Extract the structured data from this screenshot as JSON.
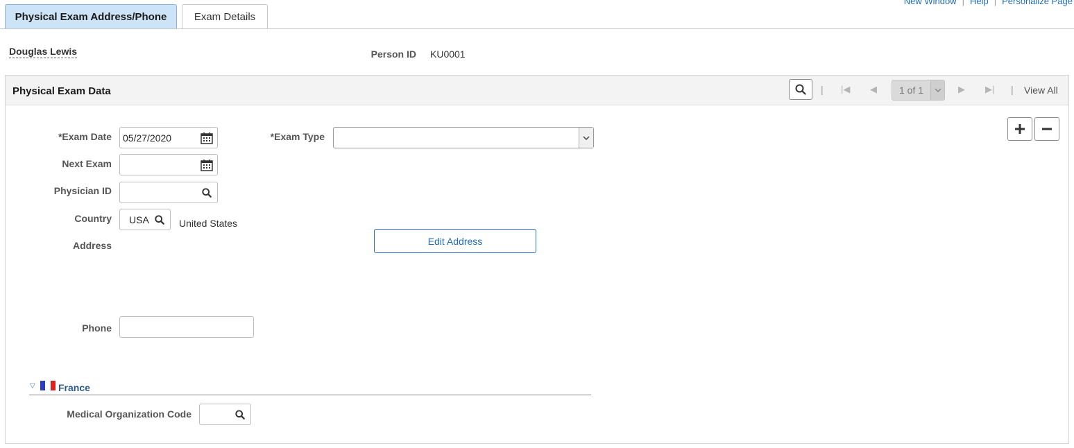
{
  "top_links": {
    "new_window": "New Window",
    "help": "Help",
    "personalize": "Personalize Page"
  },
  "tabs": [
    {
      "label": "Physical Exam Address/Phone",
      "active": true
    },
    {
      "label": "Exam Details",
      "active": false
    }
  ],
  "person": {
    "name": "Douglas Lewis",
    "id_label": "Person ID",
    "id_value": "KU0001"
  },
  "group": {
    "title": "Physical Exam Data",
    "pager_text": "1 of 1",
    "view_all": "View All"
  },
  "form": {
    "exam_date_label": "*Exam Date",
    "exam_date_value": "05/27/2020",
    "exam_type_label": "*Exam Type",
    "exam_type_value": "",
    "next_exam_label": "Next Exam",
    "next_exam_value": "",
    "physician_id_label": "Physician ID",
    "physician_id_value": "",
    "country_label": "Country",
    "country_value": "USA",
    "country_desc": "United States",
    "address_label": "Address",
    "edit_address_button": "Edit Address",
    "phone_label": "Phone",
    "phone_value": ""
  },
  "france": {
    "label": "France",
    "med_org_label": "Medical Organization Code",
    "med_org_value": ""
  },
  "colors": {
    "link_blue": "#1f6dba",
    "active_tab_bg": "#cde3f7",
    "header_bg": "#f3f3f3"
  }
}
